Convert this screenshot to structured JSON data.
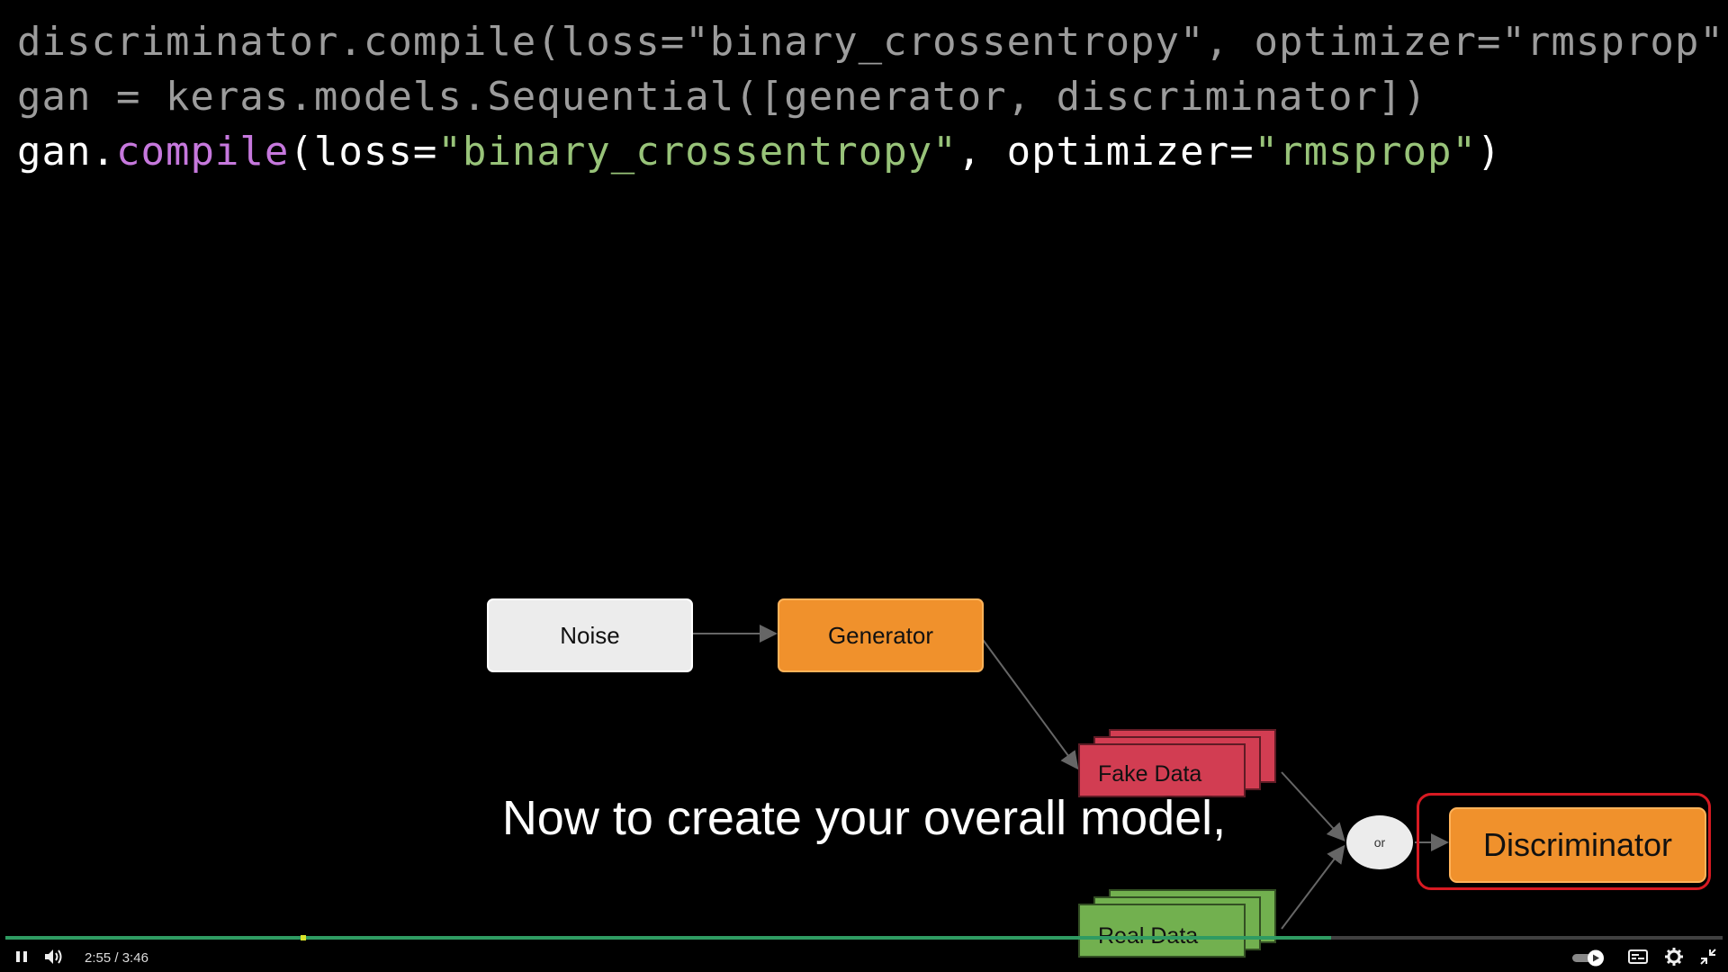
{
  "code": {
    "line1": {
      "text": "discriminator.compile(loss=\"binary_crossentropy\", optimizer=\"rmsprop\")"
    },
    "line2": {
      "text": "gan = keras.models.Sequential([generator, discriminator])"
    },
    "line3": {
      "prefix": "gan.",
      "method": "compile",
      "open": "(loss=",
      "q1": "\"",
      "loss_value": "binary_crossentropy",
      "q2": "\"",
      "mid": ", optimizer=",
      "q3": "\"",
      "optimizer_value": "rmsprop",
      "q4": "\"",
      "close": ")"
    }
  },
  "diagram": {
    "noise_label": "Noise",
    "generator_label": "Generator",
    "fake_data_label": "Fake Data",
    "real_data_label": "Real Data",
    "or_label": "or",
    "discriminator_label": "Discriminator"
  },
  "caption": "Now to create your overall model,",
  "player": {
    "current_time": "2:55",
    "separator": "/",
    "duration": "3:46",
    "progress_fraction": 0.772,
    "buffered_fraction": 0.772,
    "icons": [
      "pause-icon",
      "volume-icon",
      "autoplay-toggle",
      "subtitles-icon",
      "settings-icon",
      "exit-fullscreen-icon"
    ]
  },
  "colors": {
    "code_method": "#c678dd",
    "code_string": "#98c379",
    "generator": "#f0912c",
    "fake_data": "#d23d52",
    "real_data": "#72b04f",
    "discriminator_highlight": "#d71a22",
    "progress": "#2f9b62"
  }
}
